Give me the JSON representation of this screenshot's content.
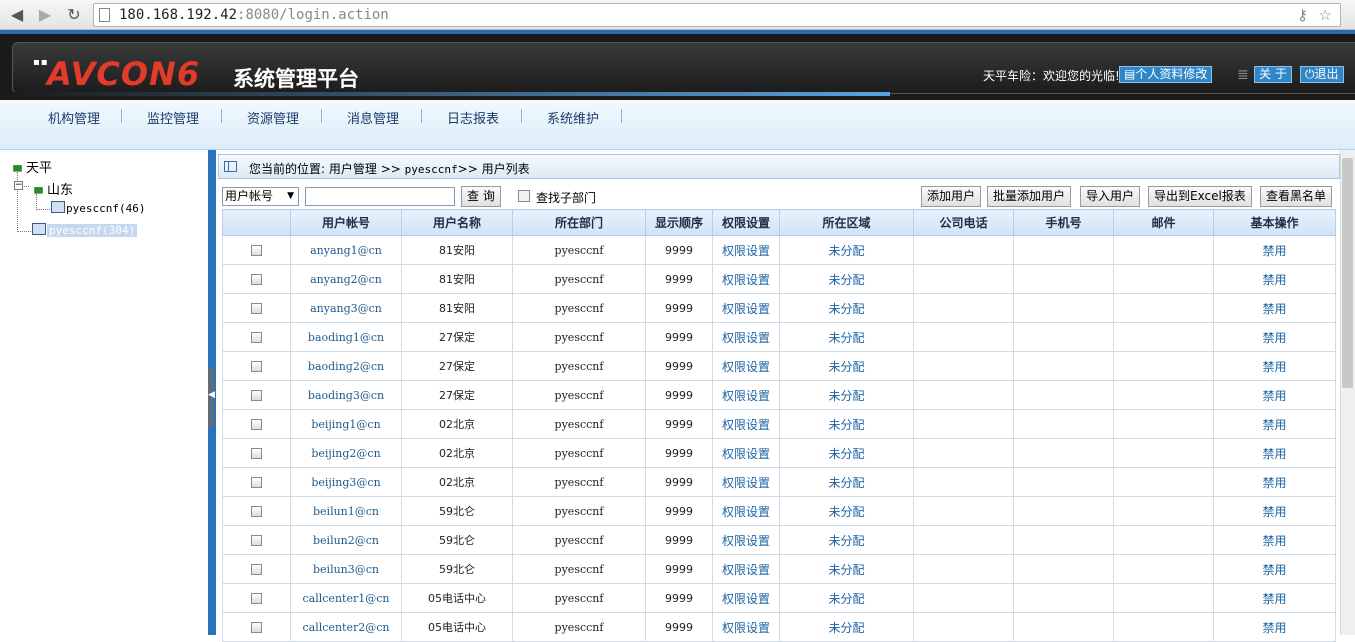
{
  "browser": {
    "url_host": "180.168.192.42",
    "url_rest": ":8080/login.action"
  },
  "header": {
    "logo": "AVCON6",
    "system_name": "系统管理平台",
    "welcome": "天平车险：欢迎您的光临!",
    "profile_btn": "个人资料修改",
    "about_btn": "关 于",
    "logout_btn": "退出"
  },
  "menu": [
    "机构管理",
    "监控管理",
    "资源管理",
    "消息管理",
    "日志报表",
    "系统维护"
  ],
  "tree": {
    "root": "天平",
    "child": "山东",
    "grandchild": "pyesccnf(46)",
    "selected": "pyesccnf(304)"
  },
  "breadcrumb": {
    "prefix": "您当前的位置:",
    "path1": "用户管理",
    "sep1": ">>",
    "path2": "pyesccnf",
    "sep2": ">>",
    "path3": "用户列表"
  },
  "toolbar": {
    "select_value": "用户帐号",
    "query_btn": "查 询",
    "subdept_label": "查找子部门",
    "add_user": "添加用户",
    "batch_add": "批量添加用户",
    "import_user": "导入用户",
    "export_excel": "导出到Excel报表",
    "blacklist": "查看黑名单"
  },
  "table": {
    "headers": [
      "",
      "用户帐号",
      "用户名称",
      "所在部门",
      "显示顺序",
      "权限设置",
      "所在区域",
      "公司电话",
      "手机号",
      "邮件",
      "基本操作"
    ],
    "rows": [
      {
        "account": "anyang1@cn",
        "name": "81安阳",
        "dept": "pyesccnf",
        "order": "9999",
        "perm": "权限设置",
        "region": "未分配",
        "op": "禁用"
      },
      {
        "account": "anyang2@cn",
        "name": "81安阳",
        "dept": "pyesccnf",
        "order": "9999",
        "perm": "权限设置",
        "region": "未分配",
        "op": "禁用"
      },
      {
        "account": "anyang3@cn",
        "name": "81安阳",
        "dept": "pyesccnf",
        "order": "9999",
        "perm": "权限设置",
        "region": "未分配",
        "op": "禁用"
      },
      {
        "account": "baoding1@cn",
        "name": "27保定",
        "dept": "pyesccnf",
        "order": "9999",
        "perm": "权限设置",
        "region": "未分配",
        "op": "禁用"
      },
      {
        "account": "baoding2@cn",
        "name": "27保定",
        "dept": "pyesccnf",
        "order": "9999",
        "perm": "权限设置",
        "region": "未分配",
        "op": "禁用"
      },
      {
        "account": "baoding3@cn",
        "name": "27保定",
        "dept": "pyesccnf",
        "order": "9999",
        "perm": "权限设置",
        "region": "未分配",
        "op": "禁用"
      },
      {
        "account": "beijing1@cn",
        "name": "02北京",
        "dept": "pyesccnf",
        "order": "9999",
        "perm": "权限设置",
        "region": "未分配",
        "op": "禁用"
      },
      {
        "account": "beijing2@cn",
        "name": "02北京",
        "dept": "pyesccnf",
        "order": "9999",
        "perm": "权限设置",
        "region": "未分配",
        "op": "禁用"
      },
      {
        "account": "beijing3@cn",
        "name": "02北京",
        "dept": "pyesccnf",
        "order": "9999",
        "perm": "权限设置",
        "region": "未分配",
        "op": "禁用"
      },
      {
        "account": "beilun1@cn",
        "name": "59北仑",
        "dept": "pyesccnf",
        "order": "9999",
        "perm": "权限设置",
        "region": "未分配",
        "op": "禁用"
      },
      {
        "account": "beilun2@cn",
        "name": "59北仑",
        "dept": "pyesccnf",
        "order": "9999",
        "perm": "权限设置",
        "region": "未分配",
        "op": "禁用"
      },
      {
        "account": "beilun3@cn",
        "name": "59北仑",
        "dept": "pyesccnf",
        "order": "9999",
        "perm": "权限设置",
        "region": "未分配",
        "op": "禁用"
      },
      {
        "account": "callcenter1@cn",
        "name": "05电话中心",
        "dept": "pyesccnf",
        "order": "9999",
        "perm": "权限设置",
        "region": "未分配",
        "op": "禁用"
      },
      {
        "account": "callcenter2@cn",
        "name": "05电话中心",
        "dept": "pyesccnf",
        "order": "9999",
        "perm": "权限设置",
        "region": "未分配",
        "op": "禁用"
      }
    ]
  },
  "colors": {
    "accent_blue": "#2b73b8",
    "logo_red": "#e23b2a",
    "link_blue": "#1c64a6"
  }
}
